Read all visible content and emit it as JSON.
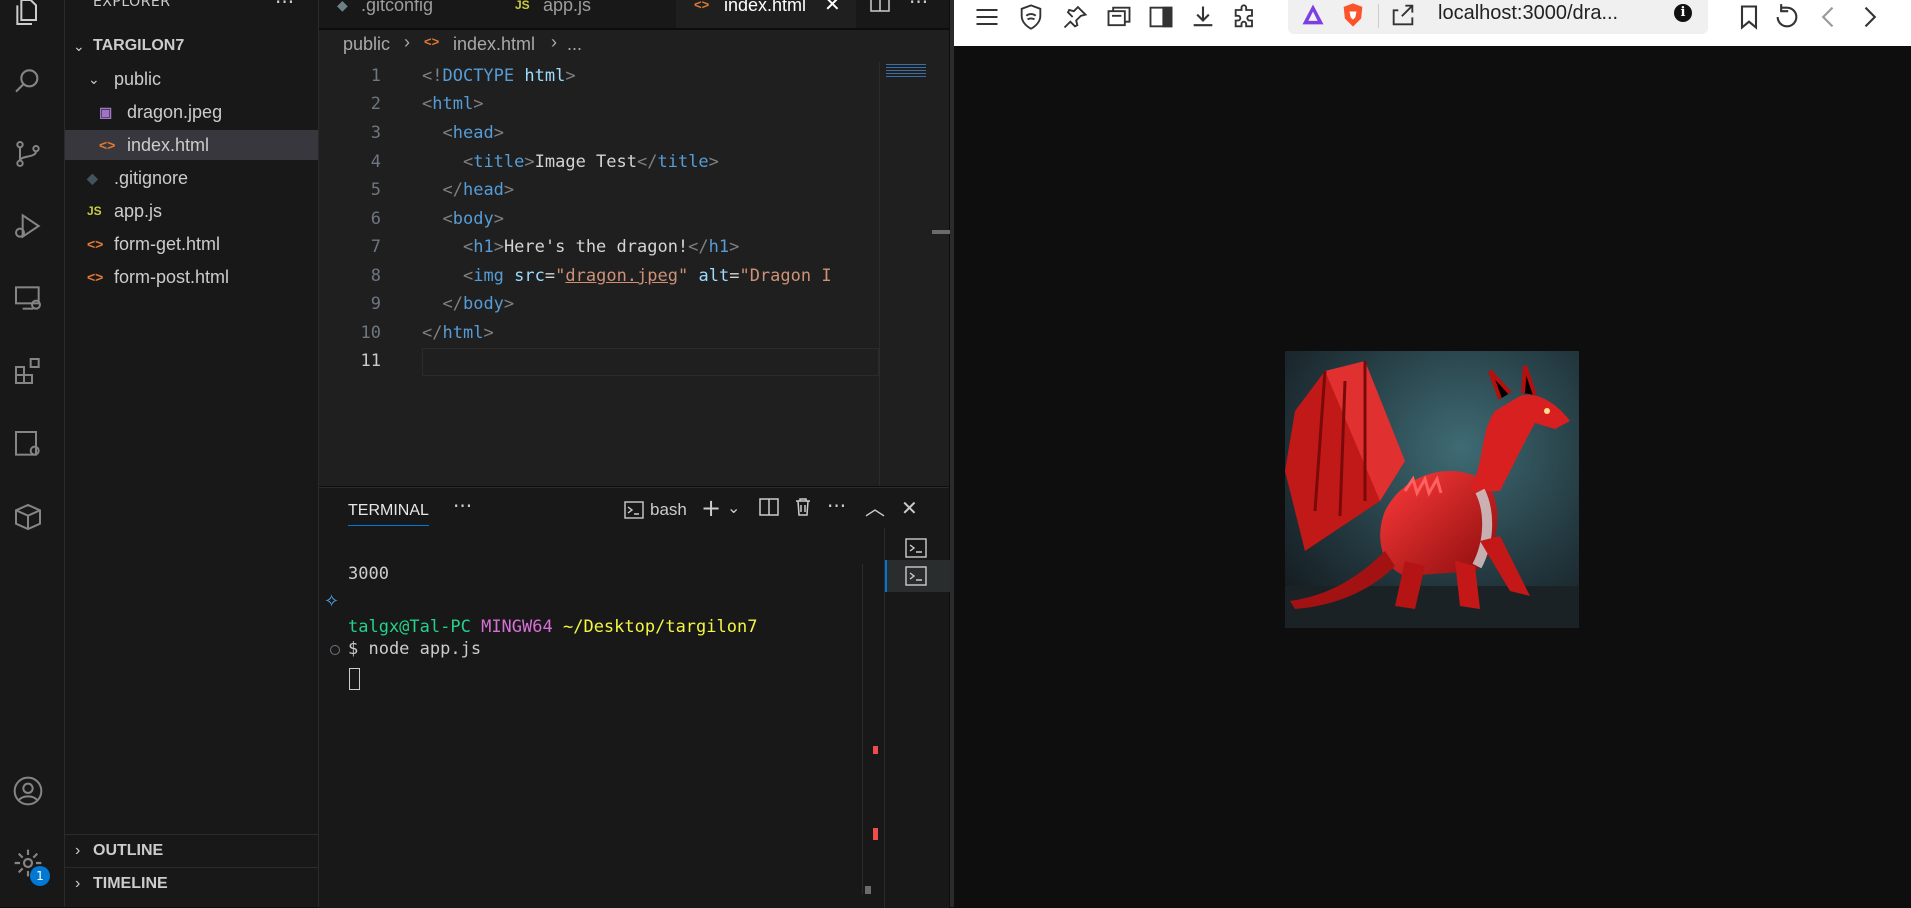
{
  "sidebar": {
    "title": "EXPLORER",
    "project": "TARGILON7",
    "folder": "public",
    "items": [
      {
        "label": "dragon.jpeg",
        "icon": "image-file-icon"
      },
      {
        "label": "index.html",
        "icon": "html-file-icon"
      },
      {
        "label": ".gitignore",
        "icon": "git-file-icon"
      },
      {
        "label": "app.js",
        "icon": "js-file-icon",
        "icon_text": "JS"
      },
      {
        "label": "form-get.html",
        "icon": "html-file-icon"
      },
      {
        "label": "form-post.html",
        "icon": "html-file-icon"
      }
    ],
    "sections": [
      "OUTLINE",
      "TIMELINE"
    ],
    "badge": "1"
  },
  "editor": {
    "tabs": [
      {
        "label": ".gitconfig"
      },
      {
        "label": "app.js",
        "icon_text": "JS"
      },
      {
        "label": "index.html",
        "active": true
      }
    ],
    "breadcrumb": [
      "public",
      "index.html",
      "..."
    ],
    "line_numbers": [
      "1",
      "2",
      "3",
      "4",
      "5",
      "6",
      "7",
      "8",
      "9",
      "10",
      "11"
    ],
    "code": {
      "l1_a": "<!",
      "l1_b": "DOCTYPE",
      "l1_c": "html",
      "l1_d": ">",
      "l2": "html",
      "l3": "head",
      "l4_tag": "title",
      "l4_text": "Image Test",
      "l5": "head",
      "l6": "body",
      "l7_tag": "h1",
      "l7_text": "Here's the dragon!",
      "l8_tag": "img",
      "l8_attr1": "src",
      "l8_val1": "dragon.jpeg",
      "l8_attr2": "alt",
      "l8_val2": "\"Dragon I",
      "l9": "body",
      "l10": "html"
    }
  },
  "terminal": {
    "tab_label": "TERMINAL",
    "shell": "bash",
    "output_port": "3000",
    "prompt_user": "talgx@Tal-PC",
    "prompt_env": "MINGW64",
    "prompt_path": "~/Desktop/targilon7",
    "command": "$ node app.js"
  },
  "browser": {
    "url": "localhost:3000/dra...",
    "image_alt": "Red dragon image"
  },
  "colors": {
    "accent": "#0078d4",
    "terminal_user": "#23d18b",
    "terminal_env": "#d670d6",
    "terminal_path": "#f5f543"
  }
}
